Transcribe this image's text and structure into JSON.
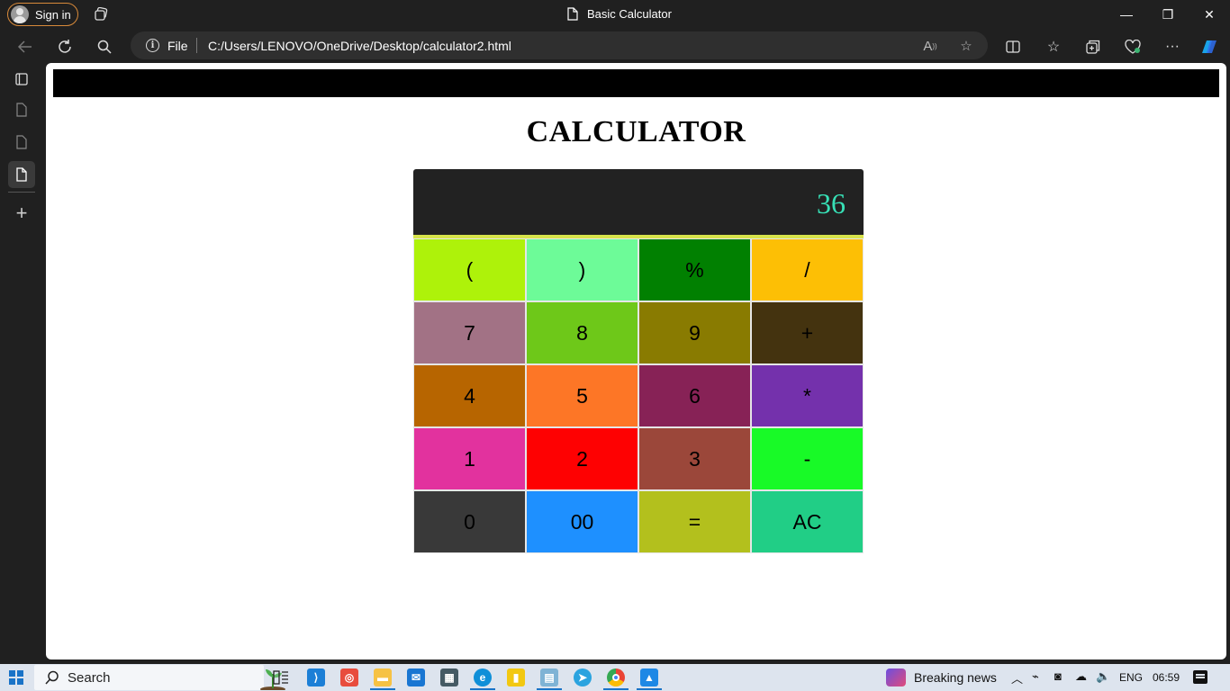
{
  "browser": {
    "sign_in_label": "Sign in",
    "window_title": "Basic Calculator",
    "address": {
      "scheme_label": "File",
      "url": "C:/Users/LENOVO/OneDrive/Desktop/calculator2.html"
    },
    "window_controls": {
      "minimize": "—",
      "restore": "❐",
      "close": "✕"
    }
  },
  "page": {
    "heading": "CALCULATOR",
    "display_value": "36",
    "keys": [
      {
        "label": "(",
        "color": "#aef20a"
      },
      {
        "label": ")",
        "color": "#6dfb98"
      },
      {
        "label": "%",
        "color": "#018001"
      },
      {
        "label": "/",
        "color": "#fdbf05"
      },
      {
        "label": "7",
        "color": "#a27285"
      },
      {
        "label": "8",
        "color": "#6ec819"
      },
      {
        "label": "9",
        "color": "#897b01"
      },
      {
        "label": "+",
        "color": "#44330f"
      },
      {
        "label": "4",
        "color": "#b76500"
      },
      {
        "label": "5",
        "color": "#fd7626"
      },
      {
        "label": "6",
        "color": "#872256"
      },
      {
        "label": "*",
        "color": "#7431ac"
      },
      {
        "label": "1",
        "color": "#e2329e"
      },
      {
        "label": "2",
        "color": "#fe0102"
      },
      {
        "label": "3",
        "color": "#9b473a"
      },
      {
        "label": "-",
        "color": "#18fa27"
      },
      {
        "label": "0",
        "color": "#393939"
      },
      {
        "label": "00",
        "color": "#1e90ff"
      },
      {
        "label": "=",
        "color": "#b3c01d"
      },
      {
        "label": "AC",
        "color": "#21ce86"
      }
    ],
    "display_text_color": "#37e0b6",
    "display_border_color": "#d7e34a"
  },
  "taskbar": {
    "search_label": "Search",
    "news_label": "Breaking news",
    "language": "ENG",
    "time": "06:59"
  }
}
